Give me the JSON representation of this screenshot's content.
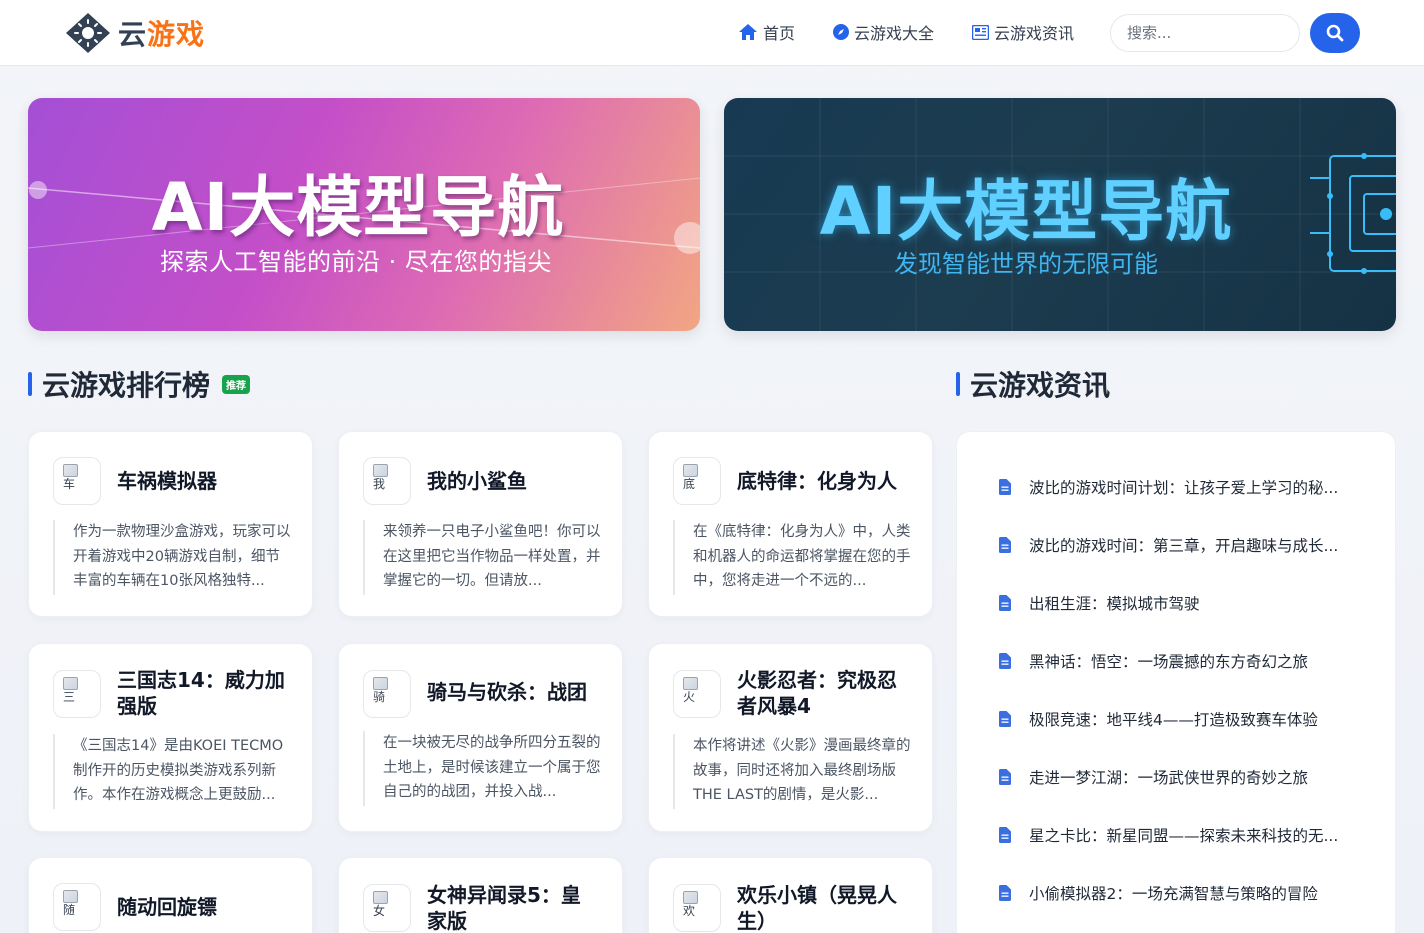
{
  "header": {
    "logo_text_a": "云",
    "logo_text_b": "游戏",
    "nav": [
      {
        "label": "首页",
        "icon": "home-icon"
      },
      {
        "label": "云游戏大全",
        "icon": "compass-icon"
      },
      {
        "label": "云游戏资讯",
        "icon": "newspaper-icon"
      }
    ],
    "search_placeholder": "搜索..."
  },
  "banners": [
    {
      "title": "AI大模型导航",
      "subtitle": "探索人工智能的前沿 · 尽在您的指尖"
    },
    {
      "title": "AI大模型导航",
      "subtitle": "发现智能世界的无限可能"
    }
  ],
  "ranking": {
    "title": "云游戏排行榜",
    "badge": "推荐",
    "games": [
      {
        "name": "车祸模拟器",
        "icon_alt": "车",
        "desc": "作为一款物理沙盒游戏，玩家可以开着游戏中20辆游戏自制，细节丰富的车辆在10张风格独特..."
      },
      {
        "name": "我的小鲨鱼",
        "icon_alt": "我",
        "desc": "来领养一只电子小鲨鱼吧！你可以在这里把它当作物品一样处置，并掌握它的一切。但请放..."
      },
      {
        "name": "底特律：化身为人",
        "icon_alt": "底",
        "desc": "在《底特律：化身为人》中，人类和机器人的命运都将掌握在您的手中，您将走进一个不远的..."
      },
      {
        "name": "三国志14：威力加强版",
        "icon_alt": "三",
        "desc": "《三国志14》是由KOEI TECMO制作开的历史模拟类游戏系列新作。本作在游戏概念上更鼓励..."
      },
      {
        "name": "骑马与砍杀：战团",
        "icon_alt": "骑",
        "desc": "在一块被无尽的战争所四分五裂的土地上，是时候该建立一个属于您自己的的战团，并投入战..."
      },
      {
        "name": "火影忍者：究极忍者风暴4",
        "icon_alt": "火",
        "desc": "本作将讲述《火影》漫画最终章的故事，同时还将加入最终剧场版THE LAST的剧情，是火影..."
      },
      {
        "name": "随动回旋镖",
        "icon_alt": "随",
        "desc": ""
      },
      {
        "name": "女神异闻录5：皇家版",
        "icon_alt": "女",
        "desc": ""
      },
      {
        "name": "欢乐小镇（晃晃人生）",
        "icon_alt": "欢",
        "desc": ""
      }
    ]
  },
  "news": {
    "title": "云游戏资讯",
    "items": [
      "波比的游戏时间计划：让孩子爱上学习的秘...",
      "波比的游戏时间：第三章，开启趣味与成长...",
      "出租生涯：模拟城市驾驶",
      "黑神话：悟空：一场震撼的东方奇幻之旅",
      "极限竞速：地平线4——打造极致赛车体验",
      "走进一梦江湖：一场武侠世界的奇妙之旅",
      "星之卡比：新星同盟——探索未来科技的无...",
      "小偷模拟器2：一场充满智慧与策略的冒险"
    ]
  },
  "colors": {
    "accent": "#2563eb",
    "brand_orange": "#f97316",
    "badge_green": "#16a34a"
  }
}
